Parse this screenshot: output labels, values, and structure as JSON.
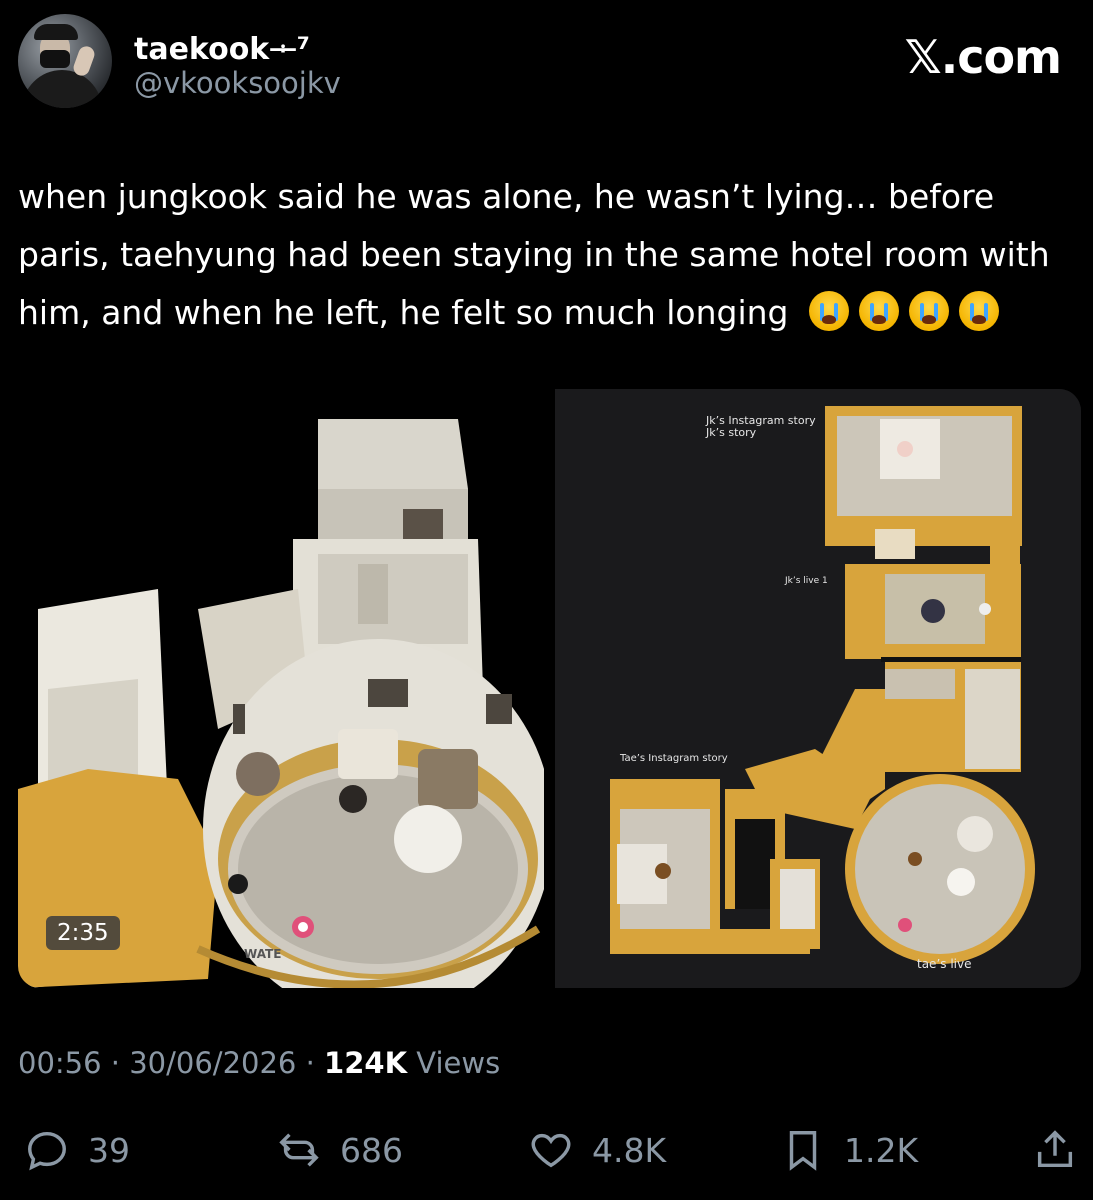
{
  "author": {
    "name": "taekook",
    "name_suffix": "ᆠ⁷",
    "handle": "@vkooksoojkv"
  },
  "brand": "𝕏.com",
  "tweet": {
    "text": "when jungkook said he was alone, he wasn’t lying… before paris, taehyung had been staying in the same hotel room with him, and when he left, he felt so much longing",
    "emojis": [
      "loudly-crying-face",
      "loudly-crying-face",
      "loudly-crying-face",
      "loudly-crying-face"
    ]
  },
  "media": {
    "video_duration": "2:35",
    "watermark": "WATE",
    "floorplan_labels": {
      "jk_instagram_story": "Jk’s Instagram story",
      "jk_story": "Jk’s story",
      "jk_live": "Jk’s live 1",
      "tae_instagram_story": "Tae’s Instagram story",
      "tae_live": "tae’s live"
    }
  },
  "meta": {
    "time": "00:56",
    "date": "30/06/2026",
    "views_count": "124K",
    "views_label": "Views",
    "separator": "·"
  },
  "actions": {
    "replies": "39",
    "reposts": "686",
    "likes": "4.8K",
    "bookmarks": "1.2K"
  },
  "colors": {
    "background": "#000000",
    "text": "#ffffff",
    "muted": "#8b98a5",
    "floor": "#d8a43c"
  }
}
